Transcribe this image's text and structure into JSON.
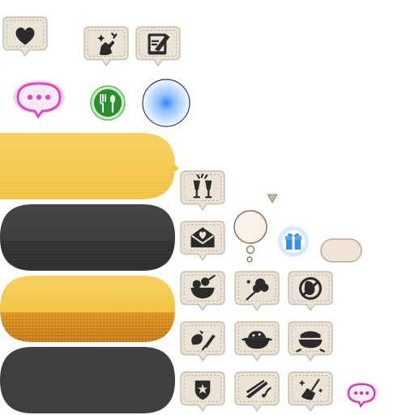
{
  "sprite_sheet": {
    "colors": {
      "background": "#ffffff",
      "bubble_fill": "#eae3d6",
      "bubble_outline": "#c9c0b0",
      "icon_ink": "#2b2b2b",
      "pink_glow": "#e87ad0",
      "pink_bubble": "#fbe9f7",
      "pink_dots": "#d64fb4",
      "green_badge": "#2e8b2e",
      "blue_glow": "#2f86ff",
      "gold_bar": "#f5cb52",
      "gold_bar_dark": "#c98218",
      "dark_bar": "#3d3d3d",
      "blank_pill": "#eee3d4"
    },
    "status_icons": [
      "heart-icon",
      "sparkle-hand-icon",
      "notepad-quill-icon",
      "champagne-toast-icon",
      "envelope-heart-icon",
      "fruit-bowl-icon",
      "cotton-candy-icon",
      "no-symbol-icon",
      "eggplant-knife-icon",
      "stew-pot-icon",
      "cake-bowl-icon",
      "police-badge-icon",
      "shooting-star-icon",
      "broom-sparkle-icon"
    ],
    "special_icons": [
      "pink-chat-bubble-icon",
      "fork-spoon-icon",
      "blue-glow-orb-icon",
      "small-arrow-down-icon",
      "thought-bubble-icon",
      "gift-box-icon",
      "blank-pill-icon",
      "small-pink-chat-bubble-icon"
    ],
    "bars": [
      "gold-bar",
      "dark-bar",
      "gold-split-bar",
      "dark-bar"
    ]
  }
}
